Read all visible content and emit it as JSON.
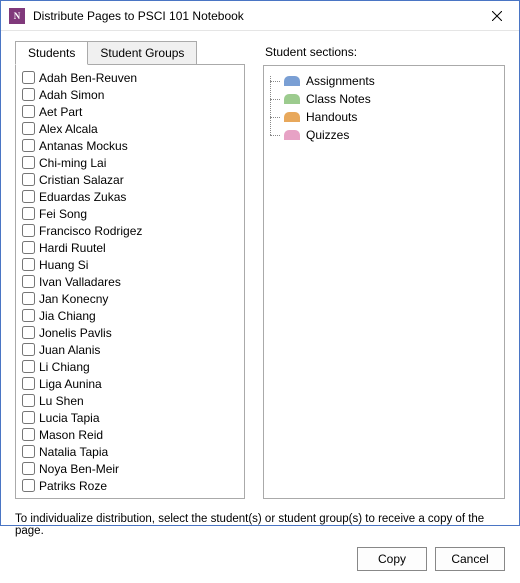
{
  "window": {
    "title": "Distribute Pages to PSCI 101 Notebook"
  },
  "tabs": {
    "students": "Students",
    "groups": "Student Groups"
  },
  "students": [
    "Adah Ben-Reuven",
    "Adah Simon",
    "Aet Part",
    "Alex Alcala",
    "Antanas Mockus",
    "Chi-ming Lai",
    "Cristian Salazar",
    "Eduardas Zukas",
    "Fei Song",
    "Francisco Rodrigez",
    "Hardi Ruutel",
    "Huang Si",
    "Ivan Valladares",
    "Jan Konecny",
    "Jia Chiang",
    "Jonelis Pavlis",
    "Juan Alanis",
    "Li Chiang",
    "Liga Aunina",
    "Lu Shen",
    "Lucia Tapia",
    "Mason Reid",
    "Natalia Tapia",
    "Noya Ben-Meir",
    "Patriks Roze"
  ],
  "sections_label": "Student sections:",
  "sections": [
    {
      "name": "Assignments",
      "color": "#7A9FD4"
    },
    {
      "name": "Class Notes",
      "color": "#9CCB8E"
    },
    {
      "name": "Handouts",
      "color": "#E8A85B"
    },
    {
      "name": "Quizzes",
      "color": "#E7A2C5"
    }
  ],
  "footer": "To individualize distribution, select the student(s) or student group(s) to receive a copy of the page.",
  "buttons": {
    "copy": "Copy",
    "cancel": "Cancel"
  }
}
